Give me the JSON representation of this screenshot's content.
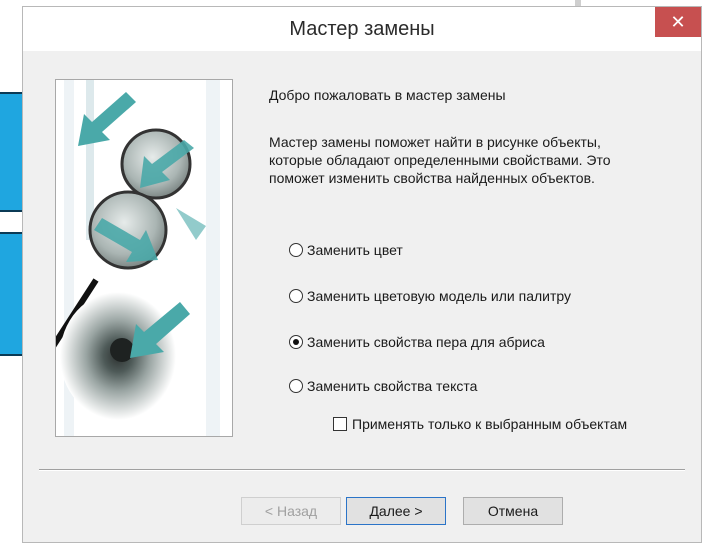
{
  "dialog": {
    "title": "Мастер замены",
    "close_glyph": "✕"
  },
  "welcome": "Добро пожаловать в мастер замены",
  "description": "Мастер замены поможет найти в рисунке объекты,\nкоторые обладают определенными свойствами. Это\nпоможет изменить свойства найденных объектов.",
  "options": [
    {
      "label": "Заменить цвет",
      "checked": false
    },
    {
      "label": "Заменить цветовую модель или палитру",
      "checked": false
    },
    {
      "label": "Заменить свойства пера для абриса",
      "checked": true
    },
    {
      "label": "Заменить свойства текста",
      "checked": false
    }
  ],
  "only_selected": {
    "label": "Применять только к выбранным объектам",
    "checked": false
  },
  "buttons": {
    "back": "< Назад",
    "next": "Далее >",
    "cancel": "Отмена"
  },
  "colors": {
    "accent_teal": "#4aa9a9",
    "close_red": "#c75050",
    "bg_panel_blue": "#1fa6e0"
  }
}
